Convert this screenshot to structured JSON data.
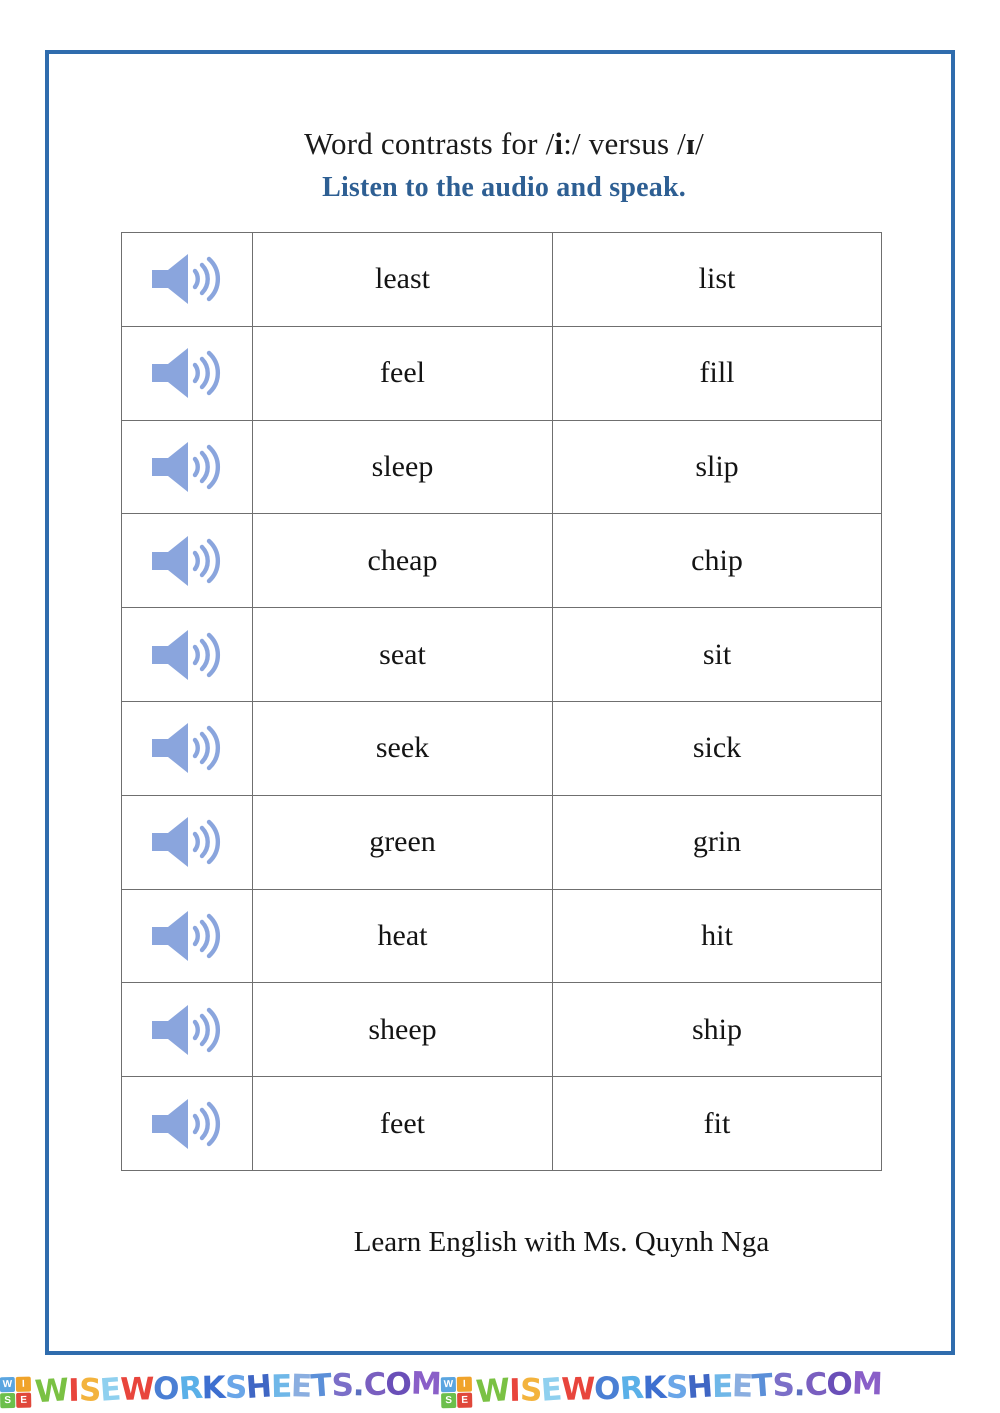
{
  "page": {
    "border_color": "#2f6cad",
    "background": "#ffffff"
  },
  "header": {
    "title_prefix": "Word contrasts for /",
    "title_vowel_long": "i",
    "title_mid": ":/ versus /",
    "title_vowel_short": "ɪ",
    "title_suffix": "/",
    "title_full": "Word contrasts for /iː/ versus /ɪ/",
    "subtitle": "Listen to the audio and speak.",
    "subtitle_color": "#2e5f93"
  },
  "table": {
    "audio_icon_name": "speaker-icon",
    "audio_icon_color": "#8aa5dd",
    "border_color": "#6f6f6f",
    "columns": [
      "audio",
      "long_vowel_word",
      "short_vowel_word"
    ],
    "rows": [
      {
        "audio": "play-audio",
        "long": "least",
        "short": "list"
      },
      {
        "audio": "play-audio",
        "long": "feel",
        "short": "fill"
      },
      {
        "audio": "play-audio",
        "long": "sleep",
        "short": "slip"
      },
      {
        "audio": "play-audio",
        "long": "cheap",
        "short": "chip"
      },
      {
        "audio": "play-audio",
        "long": "seat",
        "short": "sit"
      },
      {
        "audio": "play-audio",
        "long": "seek",
        "short": "sick"
      },
      {
        "audio": "play-audio",
        "long": "green",
        "short": "grin"
      },
      {
        "audio": "play-audio",
        "long": "heat",
        "short": "hit"
      },
      {
        "audio": "play-audio",
        "long": "sheep",
        "short": "ship"
      },
      {
        "audio": "play-audio",
        "long": "feet",
        "short": "fit"
      }
    ]
  },
  "footer": {
    "credit": "Learn English with Ms. Quynh Nga"
  },
  "watermark": {
    "logo_letters": [
      "W",
      "I",
      "S",
      "E"
    ],
    "text": "WISEWORKSHEETS.COM",
    "letter_colors": [
      "#7ac143",
      "#e8453c",
      "#f3b33d",
      "#8fd0ef",
      "#e8453c",
      "#4a7fd4",
      "#5ab0e8",
      "#3d6fd0",
      "#6aa6e8",
      "#3f66c4",
      "#6fb7e8",
      "#8aaee0",
      "#5b8fd8",
      "#7b6fc8",
      "#5a6fc0",
      "#7a5fc0",
      "#6a4fb8",
      "#8a5fc8",
      "#7f4fc0",
      "#6a3fb0"
    ],
    "repeat_count": 2
  }
}
